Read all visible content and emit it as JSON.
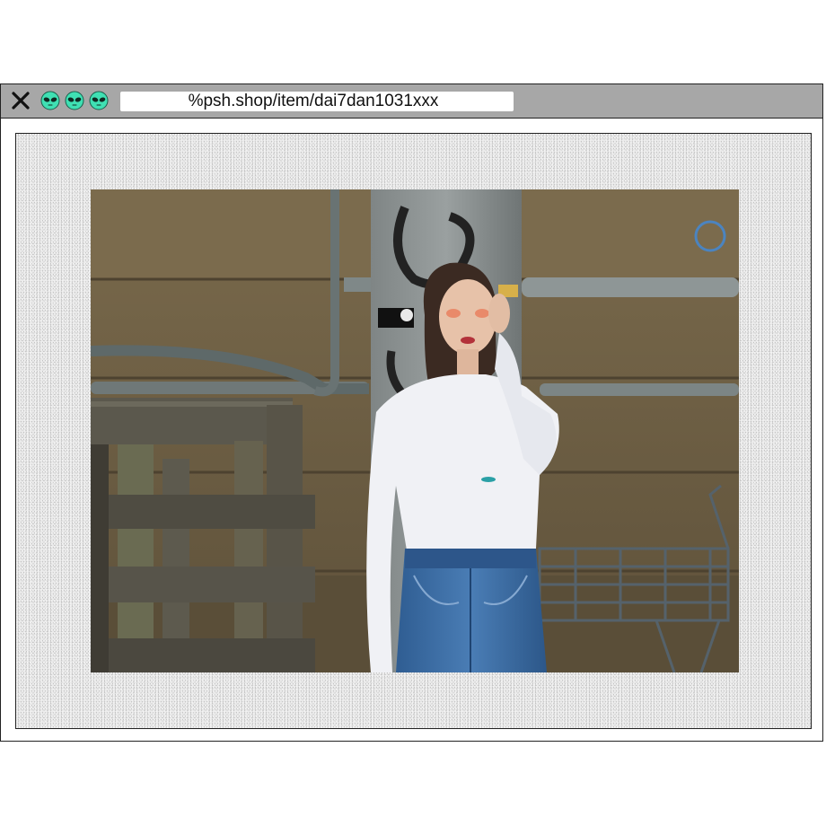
{
  "window": {
    "url": "%psh.shop/item/dai7dan1031xxx"
  },
  "icons": {
    "close": "close-icon",
    "alien_1": "alien-face-icon",
    "alien_2": "alien-face-icon",
    "alien_3": "alien-face-icon"
  },
  "colors": {
    "titlebar": "#a7a7a7",
    "alien": "#3fe0b3",
    "content_bg": "#e9e9e9"
  }
}
